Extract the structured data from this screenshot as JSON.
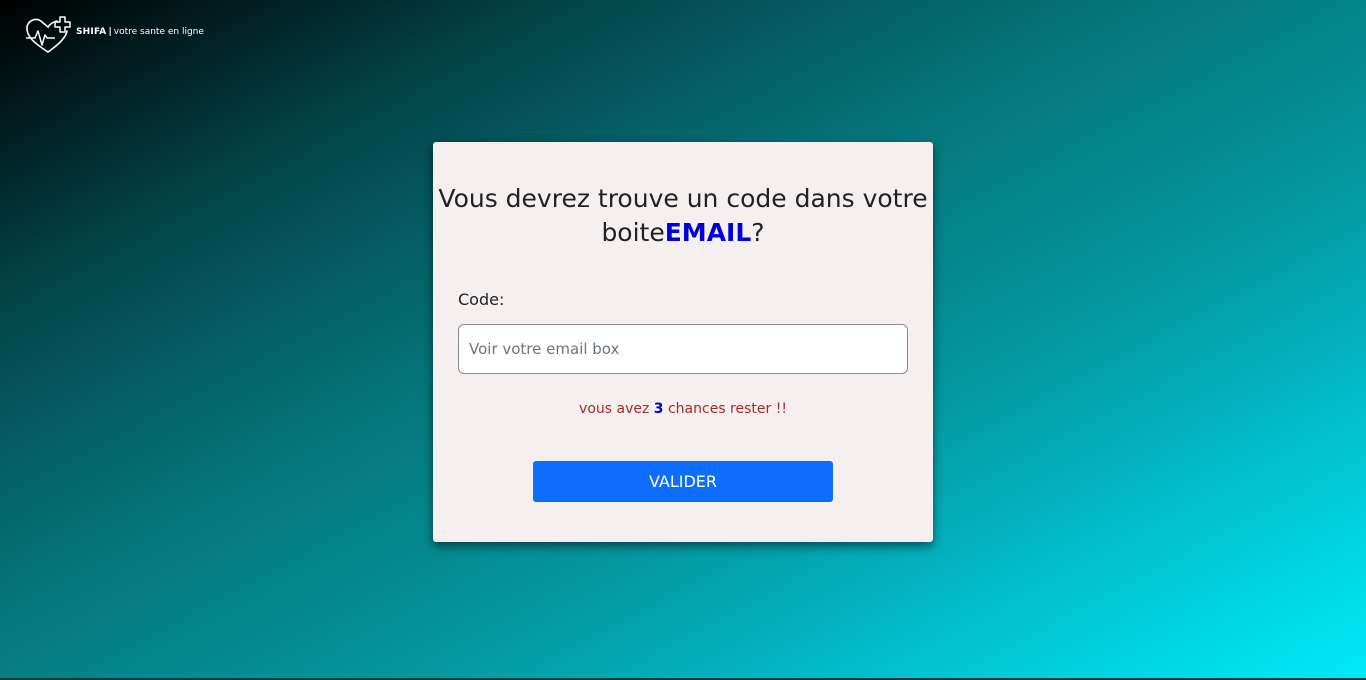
{
  "header": {
    "brand_name": "SHIFA",
    "separator": "|",
    "tagline": "votre sante en ligne",
    "logo_icon": "heart-pulse-cross-icon"
  },
  "card": {
    "title_text": "Vous devrez trouve un code dans votre boite",
    "title_highlight": "EMAIL",
    "title_suffix": "?",
    "code_label": "Code:",
    "code_input": {
      "placeholder": "Voir votre email box",
      "value": ""
    },
    "chances": {
      "prefix": "vous avez ",
      "count": "3",
      "suffix": " chances rester !!"
    },
    "submit_label": "VALIDER"
  },
  "colors": {
    "button": "#0d6efd",
    "highlight": "#0000dd",
    "warning_text": "#a52a2a",
    "card_bg": "#f5efef"
  }
}
